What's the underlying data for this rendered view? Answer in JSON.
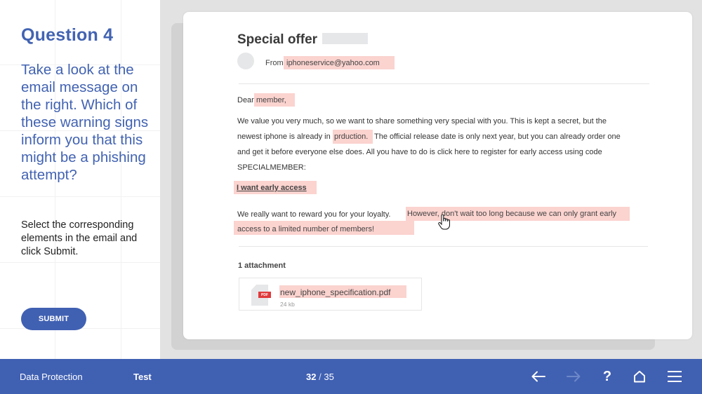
{
  "question": {
    "title": "Question 4",
    "text": "Take a look at the email message on the right. Which of these warning signs inform you that this might be a phishing attempt?",
    "instructions": "Select the corresponding elements in the email and click Submit.",
    "submit_label": "SUBMIT"
  },
  "email": {
    "subject": "Special offer",
    "from_label": "From:",
    "from_address": "iphoneservice@yahoo.com",
    "greeting_prefix": "Dear",
    "greeting_name": "member,",
    "body_lines": [
      "We value you very much, so we want to share something very special with you. This is kept a secret, but the",
      "newest iphone is already in",
      "The official release date is only next year, but you can already order one",
      "and get it before everyone else does. All you have to do is click here to register for early access using code",
      "SPECIALMEMBER:"
    ],
    "typo_word": "prduction.",
    "cta_link": "I want early access",
    "loyalty_text": "We really want to reward you for your loyalty.",
    "urgency_line1": "However, don't wait too long because we can only grant early",
    "urgency_line2": "access to a limited number of members!",
    "attachment_count": "1 attachment",
    "attachment": {
      "name": "new_iphone_specification.pdf",
      "size": "24 kb",
      "type_badge": "PDF"
    }
  },
  "highlight_color": "#fbd3cf",
  "accent_color": "#4060b2",
  "bottom_bar": {
    "course": "Data Protection",
    "section": "Test",
    "page_current": "32",
    "page_separator": "/",
    "page_total": "35",
    "icons": [
      "arrow-left-icon",
      "arrow-right-icon",
      "help-icon",
      "home-icon",
      "menu-icon"
    ],
    "help_glyph": "?"
  }
}
